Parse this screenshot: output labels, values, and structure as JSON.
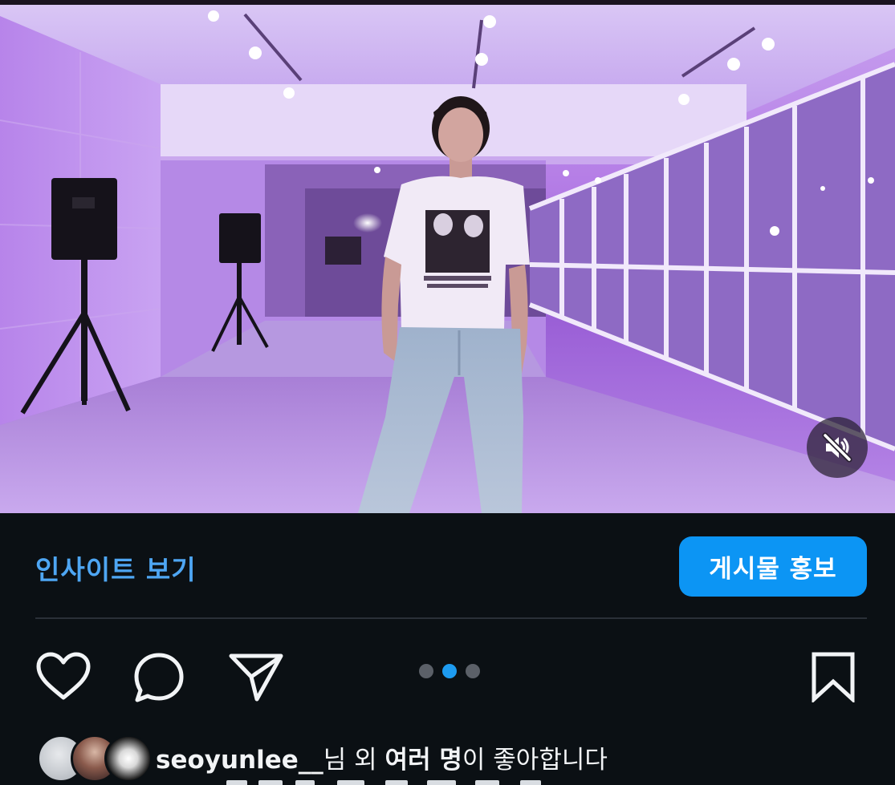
{
  "media": {
    "mute_icon": "speaker-muted-icon",
    "carousel": {
      "total": 3,
      "active_index": 1
    }
  },
  "insights": {
    "link_label": "인사이트 보기",
    "promote_label": "게시물 홍보"
  },
  "actions": {
    "like_icon": "heart-icon",
    "comment_icon": "comment-bubble-icon",
    "share_icon": "paper-plane-icon",
    "save_icon": "bookmark-icon"
  },
  "likes": {
    "username": "seoyunlee__",
    "suffix_1": "님 외 ",
    "bold_phrase": "여러 명",
    "suffix_2": "이 좋아합니다"
  },
  "colors": {
    "background": "#0b1014",
    "link_blue": "#4ea6f3",
    "button_blue": "#0c95f4",
    "active_dot": "#1d9bf0",
    "inactive_dot": "#5b6068"
  }
}
